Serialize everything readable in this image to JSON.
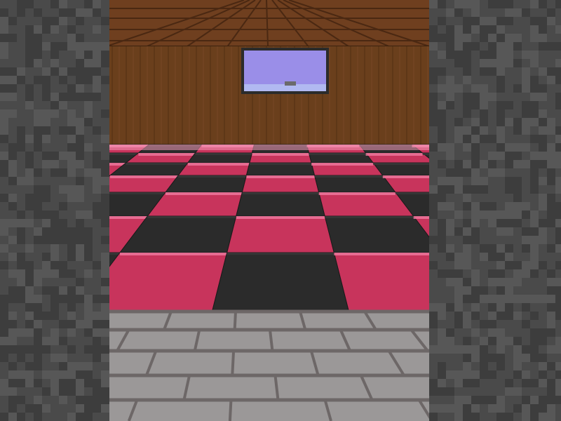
{
  "scene": {
    "type": "first-person block game view",
    "palette": {
      "ceiling": "#6f3f1f",
      "ceiling_seam": "#4a2812",
      "back_wall": "#6a3f1c",
      "back_wall_dark": "#5a3416",
      "sky": "#9a8ee8",
      "pink": "#c8345c",
      "pink_light": "#e85a88",
      "pink_edge": "#f07aa0",
      "black": "#2b2b2b",
      "black_light": "#3a3a3a",
      "stone_dark": "#3d3d3d",
      "stone_mid": "#4a4a4a",
      "stone_light": "#575757",
      "brick_face": "#9b9898",
      "brick_mortar": "#6d6767"
    },
    "objects": [
      {
        "name": "left-cobblestone-wall",
        "icon": "cobblestone-block"
      },
      {
        "name": "right-cobblestone-wall",
        "icon": "cobblestone-block"
      },
      {
        "name": "wooden-plank-ceiling",
        "icon": "oak-planks"
      },
      {
        "name": "wooden-back-wall",
        "icon": "oak-planks"
      },
      {
        "name": "glass-window",
        "icon": "glass-pane"
      },
      {
        "name": "checkered-glass-floor",
        "icon": "stained-glass"
      },
      {
        "name": "stone-brick-floor",
        "icon": "stone-bricks"
      }
    ]
  }
}
